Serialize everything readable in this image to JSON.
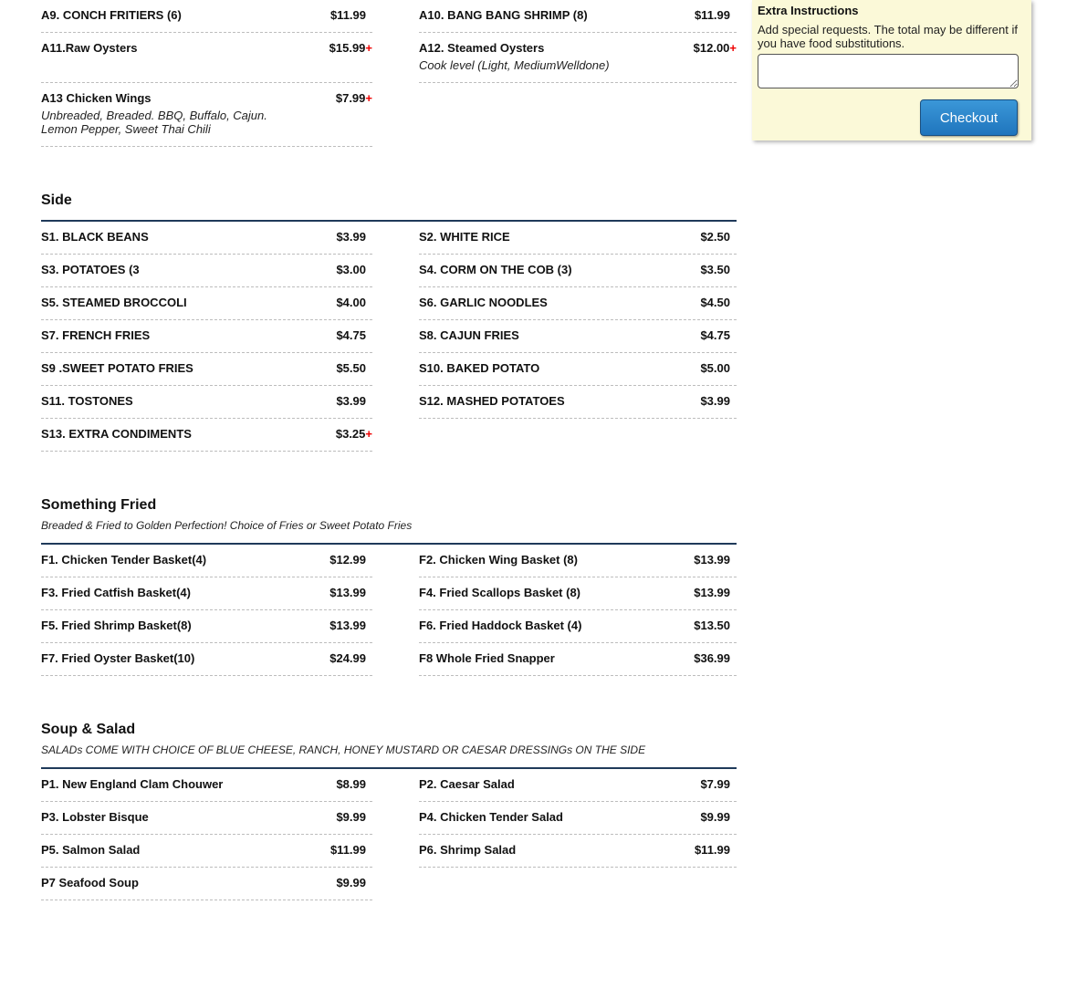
{
  "top_items": [
    {
      "name": "A9. CONCH FRITIERS (6)",
      "price": "$11.99"
    },
    {
      "name": "A10. BANG BANG SHRIMP (8)",
      "price": "$11.99"
    },
    {
      "name": "A11.Raw Oysters",
      "price": "$15.99",
      "plus": "+"
    },
    {
      "name": "A12. Steamed Oysters",
      "price": "$12.00",
      "plus": "+",
      "desc": "Cook level (Light, MediumWelldone)"
    },
    {
      "name": "A13 Chicken Wings",
      "price": "$7.99",
      "plus": "+",
      "desc": "Unbreaded, Breaded. BBQ, Buffalo, Cajun. Lemon Pepper, Sweet Thai Chili"
    }
  ],
  "sections": [
    {
      "title": "Side",
      "items": [
        {
          "name": "S1. BLACK BEANS",
          "price": "$3.99"
        },
        {
          "name": "S2. WHITE RICE",
          "price": "$2.50"
        },
        {
          "name": "S3. POTATOES (3\u0010",
          "price": "$3.00"
        },
        {
          "name": "S4. CORM ON THE COB (3)",
          "price": "$3.50"
        },
        {
          "name": "S5. STEAMED BROCCOLI",
          "price": "$4.00"
        },
        {
          "name": "S6. GARLIC NOODLES",
          "price": "$4.50"
        },
        {
          "name": "S7. FRENCH FRIES",
          "price": "$4.75"
        },
        {
          "name": "S8. CAJUN FRIES",
          "price": "$4.75"
        },
        {
          "name": "S9 .SWEET POTATO FRIES",
          "price": "$5.50"
        },
        {
          "name": "S10. BAKED POTATO",
          "price": "$5.00"
        },
        {
          "name": "S11. TOSTONES",
          "price": "$3.99"
        },
        {
          "name": "S12. MASHED POTATOES",
          "price": "$3.99"
        },
        {
          "name": "S13. EXTRA CONDIMENTS",
          "price": "$3.25",
          "plus": "+"
        }
      ]
    },
    {
      "title": "Something Fried",
      "subtitle": "Breaded & Fried to Golden Perfection! Choice of Fries or Sweet Potato Fries",
      "items": [
        {
          "name": "F1. Chicken Tender Basket(4)",
          "price": "$12.99"
        },
        {
          "name": "F2. Chicken Wing Basket (8)",
          "price": "$13.99"
        },
        {
          "name": "F3. Fried Catfish Basket(4)",
          "price": "$13.99"
        },
        {
          "name": "F4. Fried Scallops Basket (8)",
          "price": "$13.99"
        },
        {
          "name": "F5. Fried Shrimp Basket(8)",
          "price": "$13.99"
        },
        {
          "name": "F6. Fried Haddock Basket (4)",
          "price": "$13.50"
        },
        {
          "name": "F7. Fried Oyster Basket(10)",
          "price": "$24.99"
        },
        {
          "name": "F8 Whole Fried Snapper",
          "price": "$36.99"
        }
      ]
    },
    {
      "title": "Soup & Salad",
      "subtitle": "SALADs COME WITH CHOICE OF BLUE CHEESE, RANCH, HONEY MUSTARD OR CAESAR DRESSINGs ON THE SIDE",
      "items": [
        {
          "name": "P1. New England Clam Chouwer",
          "price": "$8.99"
        },
        {
          "name": "P2. Caesar Salad",
          "price": "$7.99"
        },
        {
          "name": "P3. Lobster Bisque",
          "price": "$9.99"
        },
        {
          "name": "P4. Chicken Tender Salad",
          "price": "$9.99"
        },
        {
          "name": "P5. Salmon Salad",
          "price": "$11.99"
        },
        {
          "name": "P6. Shrimp Salad",
          "price": "$11.99"
        },
        {
          "name": "P7 Seafood Soup",
          "price": "$9.99"
        }
      ]
    }
  ],
  "panel": {
    "title": "Extra Instructions",
    "help": "Add special requests. The total may be different if you have food substitutions.",
    "textarea_value": "",
    "checkout_label": "Checkout"
  },
  "colors": {
    "accent_blue": "#1f75bd",
    "panel_bg": "#fbf9d8",
    "plus_red": "#e00000",
    "rule": "#1f3a5a"
  }
}
